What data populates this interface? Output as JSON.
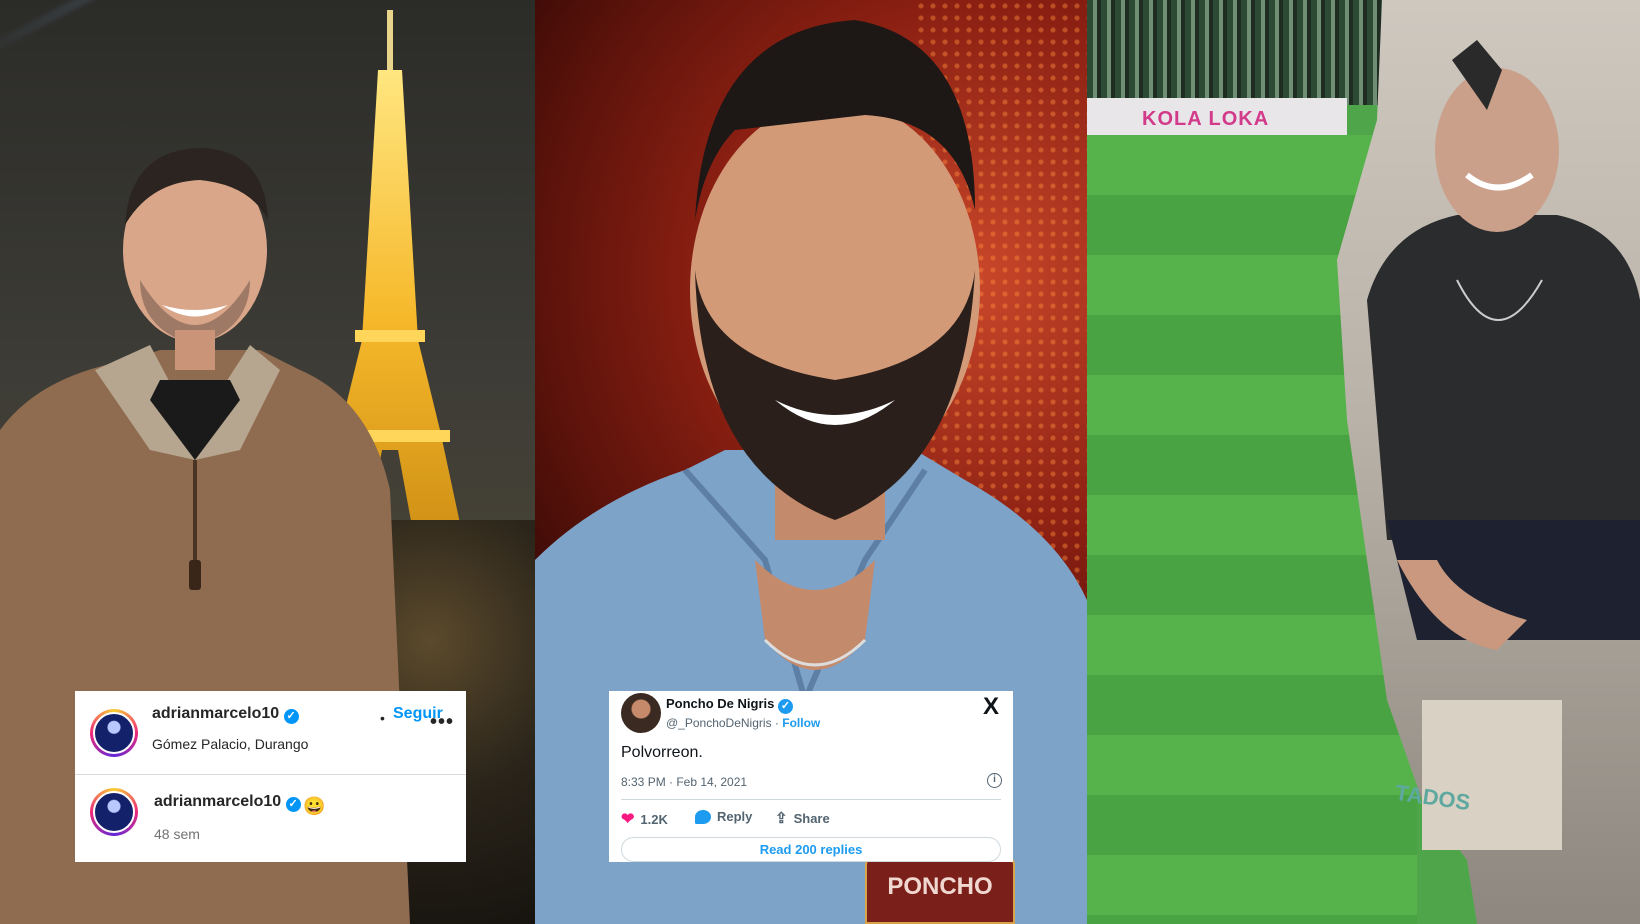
{
  "instagram": {
    "post_username": "adrianmarcelo10",
    "separator": "•",
    "follow_label": "Seguir",
    "location": "Gómez Palacio, Durango",
    "more_icon": "more-horizontal-icon",
    "comment_username": "adrianmarcelo10",
    "comment_emoji": "😀",
    "comment_time": "48 sem",
    "verified_color": "#0095f6"
  },
  "tweet": {
    "name": "Poncho De Nigris",
    "handle": "@_PonchoDeNigris",
    "dot": "·",
    "follow_label": "Follow",
    "logo": "X",
    "text": "Polvorreon.",
    "date": "8:33 PM · Feb 14, 2021",
    "info_icon": "i",
    "likes": "1.2K",
    "reply_label": "Reply",
    "share_label": "Share",
    "read_replies": "Read 200 replies",
    "accent_color": "#1d9bf0",
    "heart_color": "#f91880"
  },
  "photos": {
    "stadium_ad": "KOLA LOKA",
    "jersey_tag": "PONCHO",
    "box_text": "TADOS"
  }
}
